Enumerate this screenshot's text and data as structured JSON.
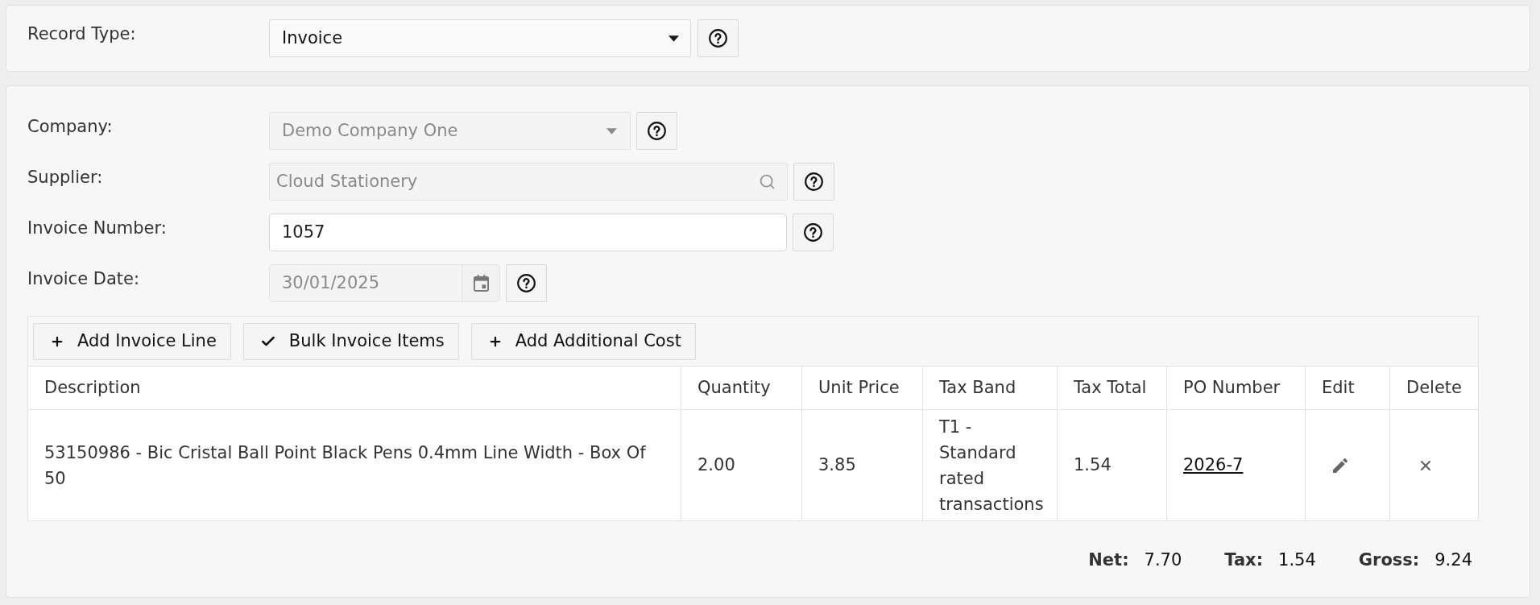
{
  "record_type": {
    "label": "Record Type:",
    "value": "Invoice"
  },
  "fields": [
    {
      "kind": "select",
      "label": "Company:",
      "value": "Demo Company One",
      "disabled": true
    },
    {
      "kind": "search",
      "label": "Supplier:",
      "value": "Cloud Stationery",
      "disabled": true
    },
    {
      "kind": "text",
      "label": "Invoice Number:",
      "value": "1057",
      "disabled": false
    },
    {
      "kind": "date",
      "label": "Invoice Date:",
      "value": "30/01/2025",
      "disabled": true
    }
  ],
  "line_toolbar": [
    {
      "kind": "add",
      "label": "Add Invoice Line"
    },
    {
      "kind": "check",
      "label": "Bulk Invoice Items"
    },
    {
      "kind": "add",
      "label": "Add Additional Cost"
    }
  ],
  "table": {
    "columns": [
      "Description",
      "Quantity",
      "Unit Price",
      "Tax Band",
      "Tax Total",
      "PO Number",
      "Edit",
      "Delete"
    ],
    "rows": [
      {
        "description": "53150986 - Bic Cristal Ball Point Black Pens 0.4mm Line Width - Box Of 50",
        "quantity": "2.00",
        "unit_price": "3.85",
        "tax_band": "T1 - Standard rated transactions",
        "tax_total": "1.54",
        "po_number": "2026-7"
      }
    ]
  },
  "totals": [
    {
      "label": "Net:",
      "value": "7.70"
    },
    {
      "label": "Tax:",
      "value": "1.54"
    },
    {
      "label": "Gross:",
      "value": "9.24"
    }
  ]
}
